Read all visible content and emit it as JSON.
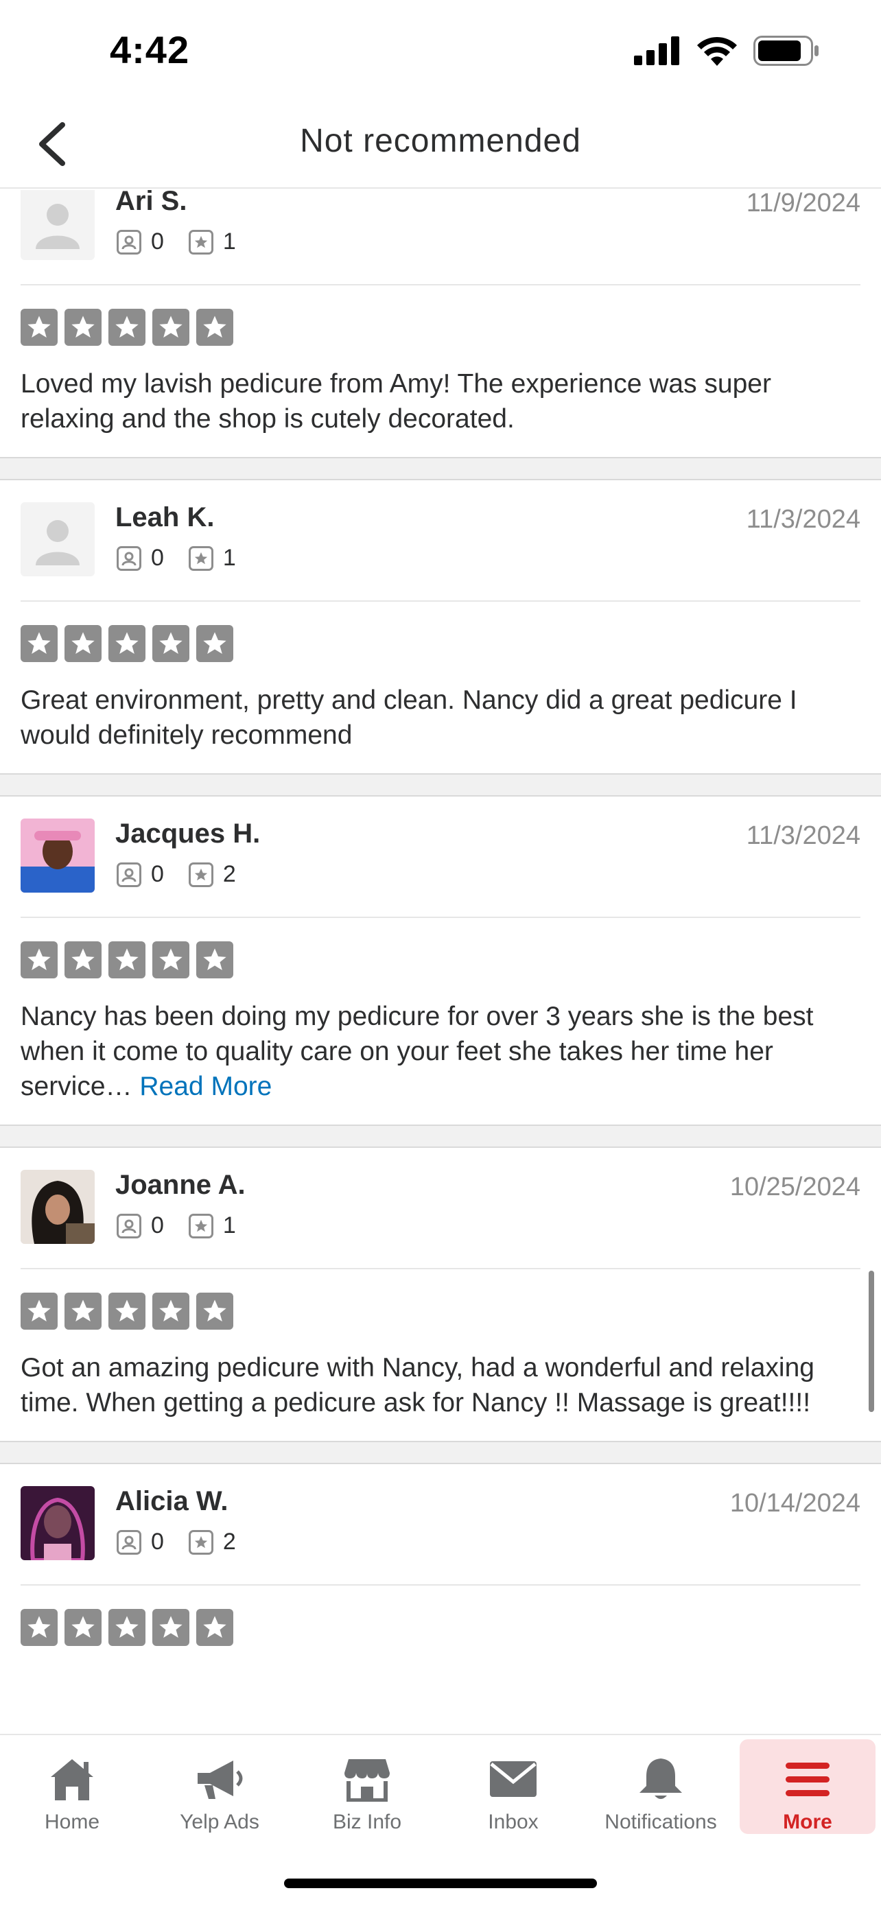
{
  "status_bar": {
    "time": "4:42"
  },
  "nav": {
    "title": "Not recommended"
  },
  "reviews": [
    {
      "name": "Ari S.",
      "date": "11/9/2024",
      "friends": "0",
      "reviews": "1",
      "text": "Loved my lavish pedicure from Amy! The experience was super relaxing and the shop is cutely decorated.",
      "read_more": ""
    },
    {
      "name": "Leah K.",
      "date": "11/3/2024",
      "friends": "0",
      "reviews": "1",
      "text": "Great environment, pretty and clean.  Nancy did a great pedicure I would definitely recommend",
      "read_more": ""
    },
    {
      "name": "Jacques H.",
      "date": "11/3/2024",
      "friends": "0",
      "reviews": "2",
      "text": "Nancy has been doing my pedicure for over 3 years she is the best when it come to quality care on your feet she takes her time her service…",
      "read_more": "Read More"
    },
    {
      "name": "Joanne A.",
      "date": "10/25/2024",
      "friends": "0",
      "reviews": "1",
      "text": "Got an amazing pedicure with Nancy, had a wonderful and relaxing time. When getting a pedicure ask for Nancy !! Massage is great!!!!",
      "read_more": ""
    },
    {
      "name": "Alicia W.",
      "date": "10/14/2024",
      "friends": "0",
      "reviews": "2",
      "text": "",
      "read_more": ""
    }
  ],
  "tabs": [
    {
      "label": "Home",
      "icon": "home-icon"
    },
    {
      "label": "Yelp Ads",
      "icon": "megaphone-icon"
    },
    {
      "label": "Biz Info",
      "icon": "storefront-icon"
    },
    {
      "label": "Inbox",
      "icon": "envelope-icon"
    },
    {
      "label": "Notifications",
      "icon": "bell-icon"
    },
    {
      "label": "More",
      "icon": "menu-icon",
      "active": true
    }
  ],
  "colors": {
    "accent": "#d32323",
    "link": "#0073bb",
    "star_inactive": "#8d8d8d"
  }
}
